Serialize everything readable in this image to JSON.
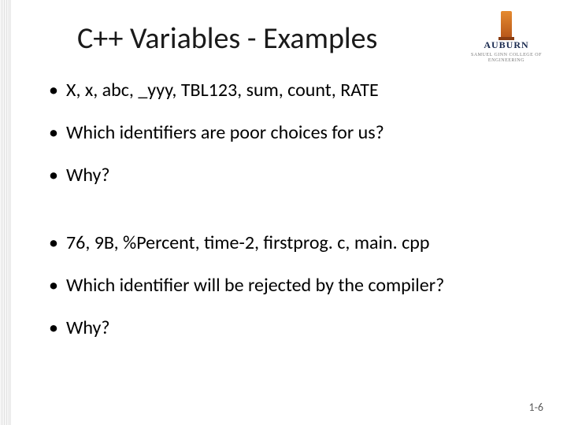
{
  "logo": {
    "wordmark": "AUBURN",
    "subtext": "SAMUEL GINN\nCOLLEGE OF ENGINEERING"
  },
  "title": "C++ Variables - Examples",
  "bullets": [
    "X, x, abc, _yyy, TBL123, sum, count, RATE",
    "Which identifiers are poor choices for us?",
    "Why?",
    "76, 9B, %Percent, time-2, firstprog. c, main. cpp",
    "Which identifier will be rejected by the compiler?",
    "Why?"
  ],
  "page_number": "1-6"
}
